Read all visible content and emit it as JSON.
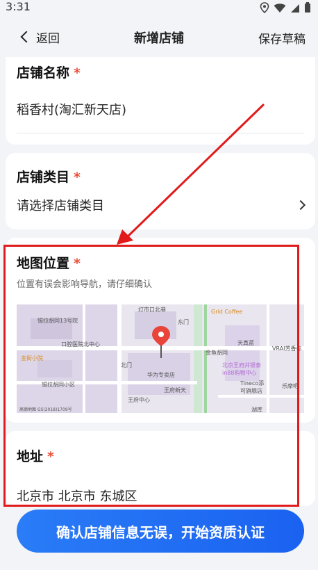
{
  "status": {
    "time": "3:31"
  },
  "nav": {
    "back_label": "返回",
    "title": "新增店铺",
    "save_draft": "保存草稿"
  },
  "store_name": {
    "label": "店铺名称",
    "required": "*",
    "value": "稻香村(淘汇新天店)"
  },
  "store_category": {
    "label": "店铺类目",
    "required": "*",
    "placeholder": "请选择店铺类目"
  },
  "map_location": {
    "label": "地图位置",
    "required": "*",
    "hint": "位置有误会影响导航，请仔细确认",
    "map_labels": [
      "锡拉胡同13号院",
      "灯市口北巷",
      "Grid Coffee",
      "东门",
      "口腔医院北中心",
      "天真蓝",
      "金鱼胡同",
      "VRAI芳香标",
      "北京王府井银泰in88购物中心",
      "金街小院",
      "华为专卖店",
      "北门",
      "王府新天",
      "锡拉胡同小区",
      "Tineco添可旗舰店",
      "乐摩吧",
      "王府中心",
      "湖库",
      "高德地图 GS(2018)1709号"
    ],
    "icons": {
      "pin": "map-pin-icon"
    }
  },
  "address": {
    "label": "地址",
    "required": "*",
    "value": "北京市 北京市 东城区"
  },
  "confirm_button": "确认店铺信息无误，开始资质认证",
  "colors": {
    "accent": "#1a62f0",
    "required": "#e8513a",
    "annotation": "#e11b1b"
  }
}
